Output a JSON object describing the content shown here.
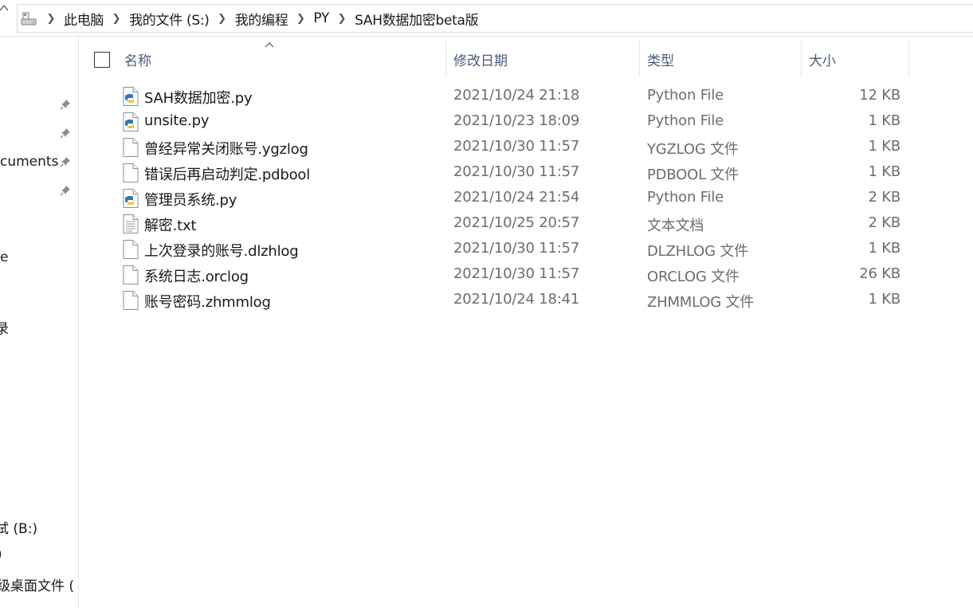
{
  "address_bar": {
    "crumbs": [
      "此电脑",
      "我的文件 (S:)",
      "我的编程",
      "PY",
      "SAH数据加密beta版"
    ]
  },
  "nav_pane": {
    "items": [
      {
        "label": "cuments"
      },
      {
        "label": "e"
      },
      {
        "label": "录"
      },
      {
        "label": "试 (B:)"
      },
      {
        "label": ")"
      },
      {
        "label": "级桌面文件 ("
      }
    ]
  },
  "columns": {
    "name": "名称",
    "date": "修改日期",
    "type": "类型",
    "size": "大小"
  },
  "files": [
    {
      "name": "SAH数据加密.py",
      "date": "2021/10/24 21:18",
      "type": "Python File",
      "size": "12 KB",
      "icon": "python-file-icon"
    },
    {
      "name": "unsite.py",
      "date": "2021/10/23 18:09",
      "type": "Python File",
      "size": "1 KB",
      "icon": "python-file-icon"
    },
    {
      "name": "曾经异常关闭账号.ygzlog",
      "date": "2021/10/30 11:57",
      "type": "YGZLOG 文件",
      "size": "1 KB",
      "icon": "blank-file-icon"
    },
    {
      "name": "错误后再启动判定.pdbool",
      "date": "2021/10/30 11:57",
      "type": "PDBOOL 文件",
      "size": "1 KB",
      "icon": "blank-file-icon"
    },
    {
      "name": "管理员系统.py",
      "date": "2021/10/24 21:54",
      "type": "Python File",
      "size": "2 KB",
      "icon": "python-file-icon"
    },
    {
      "name": "解密.txt",
      "date": "2021/10/25 20:57",
      "type": "文本文档",
      "size": "2 KB",
      "icon": "text-file-icon"
    },
    {
      "name": "上次登录的账号.dlzhlog",
      "date": "2021/10/30 11:57",
      "type": "DLZHLOG 文件",
      "size": "1 KB",
      "icon": "blank-file-icon"
    },
    {
      "name": "系统日志.orclog",
      "date": "2021/10/30 11:57",
      "type": "ORCLOG 文件",
      "size": "26 KB",
      "icon": "blank-file-icon"
    },
    {
      "name": "账号密码.zhmmlog",
      "date": "2021/10/24 18:41",
      "type": "ZHMMLOG 文件",
      "size": "1 KB",
      "icon": "blank-file-icon"
    }
  ]
}
